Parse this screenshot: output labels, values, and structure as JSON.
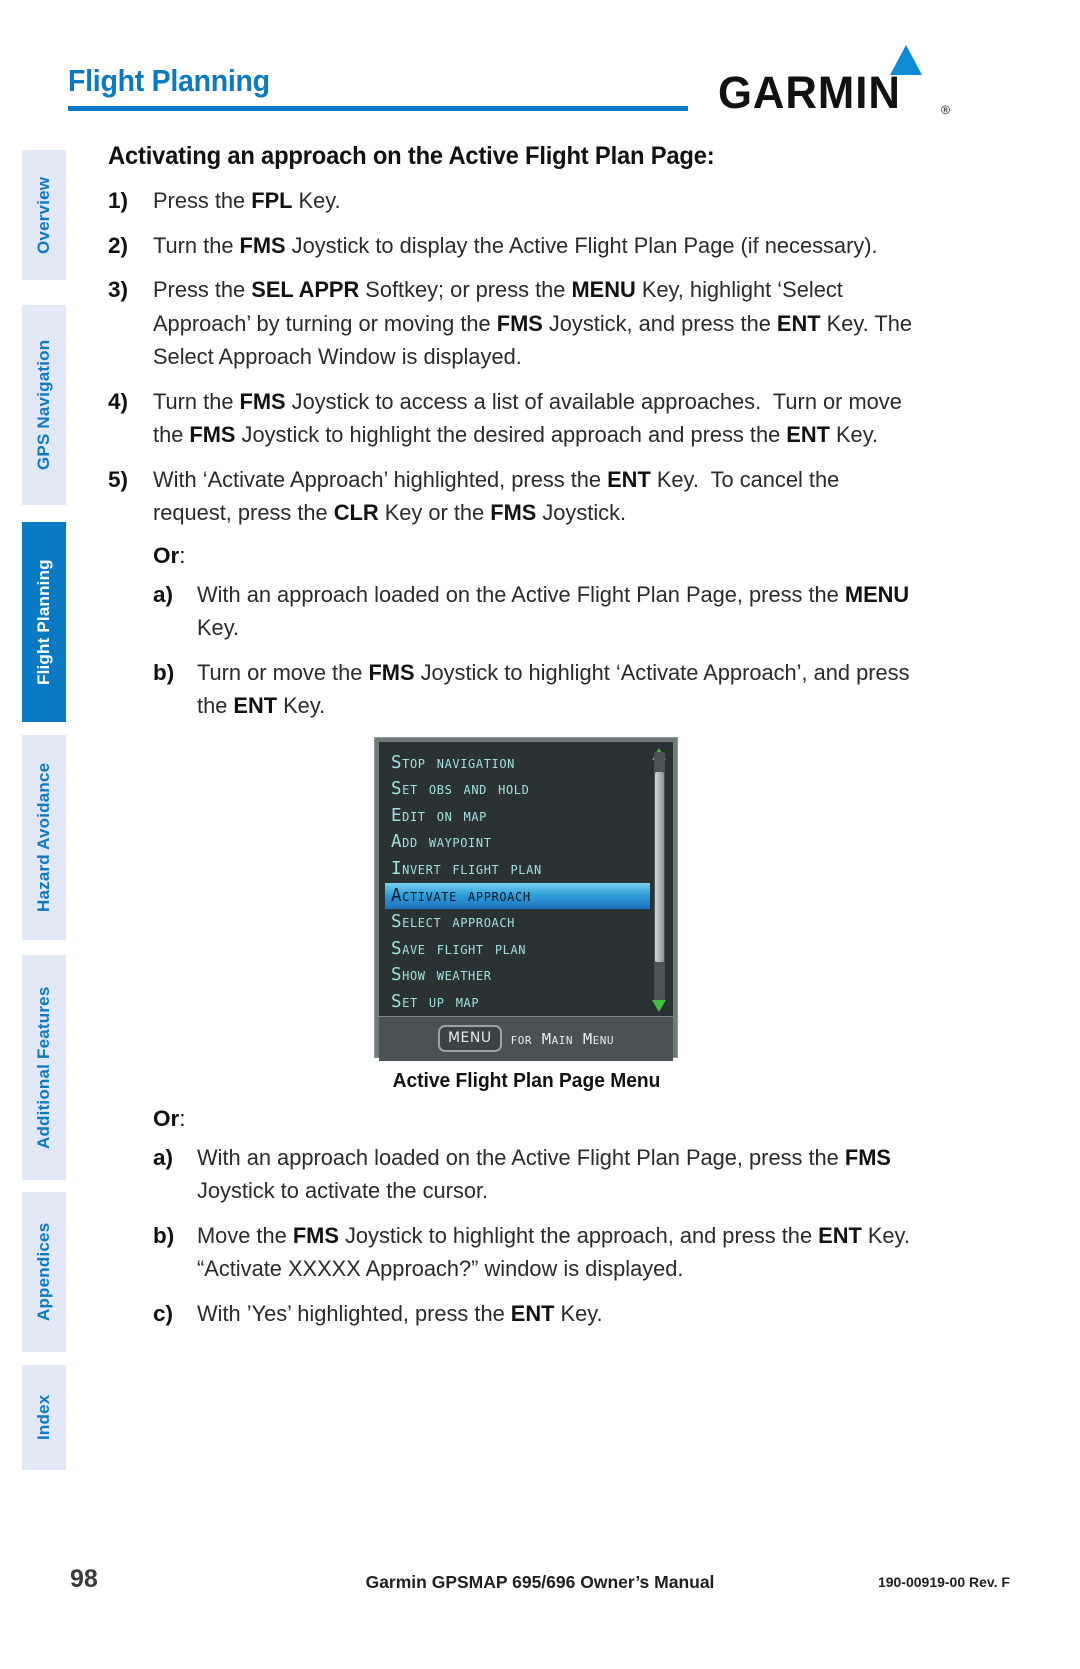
{
  "header": {
    "title": "Flight Planning",
    "brand": "GARMIN",
    "brand_registered": "®"
  },
  "sidebar": {
    "items": [
      {
        "label": "Overview",
        "active": false
      },
      {
        "label": "GPS Navigation",
        "active": false
      },
      {
        "label": "Flight Planning",
        "active": true
      },
      {
        "label": "Hazard Avoidance",
        "active": false
      },
      {
        "label": "Additional Features",
        "active": false
      },
      {
        "label": "Appendices",
        "active": false
      },
      {
        "label": "Index",
        "active": false
      }
    ]
  },
  "content": {
    "heading": "Activating an approach on the Active Flight Plan Page:",
    "steps": [
      {
        "marker": "1)",
        "html": "Press the <b>FPL</b> Key."
      },
      {
        "marker": "2)",
        "html": "Turn the <b>FMS</b> Joystick to display the Active Flight Plan Page (if necessary)."
      },
      {
        "marker": "3)",
        "html": "Press the <b>SEL APPR</b> Softkey; or press the <b>MENU</b> Key, highlight &lsquo;Select Approach&rsquo; by turning or moving the <b>FMS</b> Joystick, and press the <b>ENT</b> Key. The Select Approach Window is displayed."
      },
      {
        "marker": "4)",
        "html": "Turn the <b>FMS</b> Joystick to access a list of available approaches.&nbsp; Turn or move the <b>FMS</b> Joystick to highlight the desired approach and press the <b>ENT</b> Key."
      },
      {
        "marker": "5)",
        "html": "With &lsquo;Activate Approach&rsquo; highlighted, press the <b>ENT</b> Key.&nbsp; To cancel the request, press the <b>CLR</b> Key or the <b>FMS</b> Joystick."
      }
    ],
    "or_label_1": "Or",
    "or_colon_1": ":",
    "substeps_1": [
      {
        "marker": "a)",
        "html": "With an approach loaded on the Active Flight Plan Page, press the <b>MENU</b> Key."
      },
      {
        "marker": "b)",
        "html": "Turn or move the <b>FMS</b> Joystick to highlight &lsquo;Activate Approach&rsquo;, and press the <b>ENT</b> Key."
      }
    ],
    "or_label_2": "Or",
    "or_colon_2": ":",
    "substeps_2": [
      {
        "marker": "a)",
        "html": "With an approach loaded on the Active Flight Plan Page, press the <b>FMS</b> Joystick to activate the cursor."
      },
      {
        "marker": "b)",
        "html": "Move the <b>FMS</b> Joystick to highlight the approach, and press the <b>ENT</b> Key.&nbsp; &ldquo;Activate XXXXX Approach?&rdquo; window is displayed."
      },
      {
        "marker": "c)",
        "html": "With &rsquo;Yes&rsquo; highlighted, press the <b>ENT</b> Key."
      }
    ]
  },
  "device": {
    "menu_items": [
      {
        "label": "Stop Navigation",
        "selected": false
      },
      {
        "label": "Set OBS and Hold",
        "selected": false
      },
      {
        "label": "Edit on Map",
        "selected": false
      },
      {
        "label": "Add Waypoint",
        "selected": false
      },
      {
        "label": "Invert Flight Plan",
        "selected": false
      },
      {
        "label": "Activate Approach",
        "selected": true
      },
      {
        "label": "Select Approach",
        "selected": false
      },
      {
        "label": "Save Flight Plan",
        "selected": false
      },
      {
        "label": "Show Weather",
        "selected": false
      },
      {
        "label": "Set Up Map",
        "selected": false
      }
    ],
    "footer_key": "MENU",
    "footer_text": "for Main Menu",
    "caption": "Active Flight Plan Page Menu",
    "colors": {
      "screen_bg": "#2b3233",
      "menu_text": "#9fe2e0",
      "highlight": "#2f9fd8",
      "bezel": "#6f7a7a",
      "scroll_arrow": "#3fc33f"
    }
  },
  "footer": {
    "page_number": "98",
    "center": "Garmin GPSMAP 695/696 Owner’s Manual",
    "right": "190-00919-00  Rev. F"
  },
  "colors": {
    "brand_blue": "#0b7ac4",
    "tab_bg": "#e2e8f5"
  }
}
